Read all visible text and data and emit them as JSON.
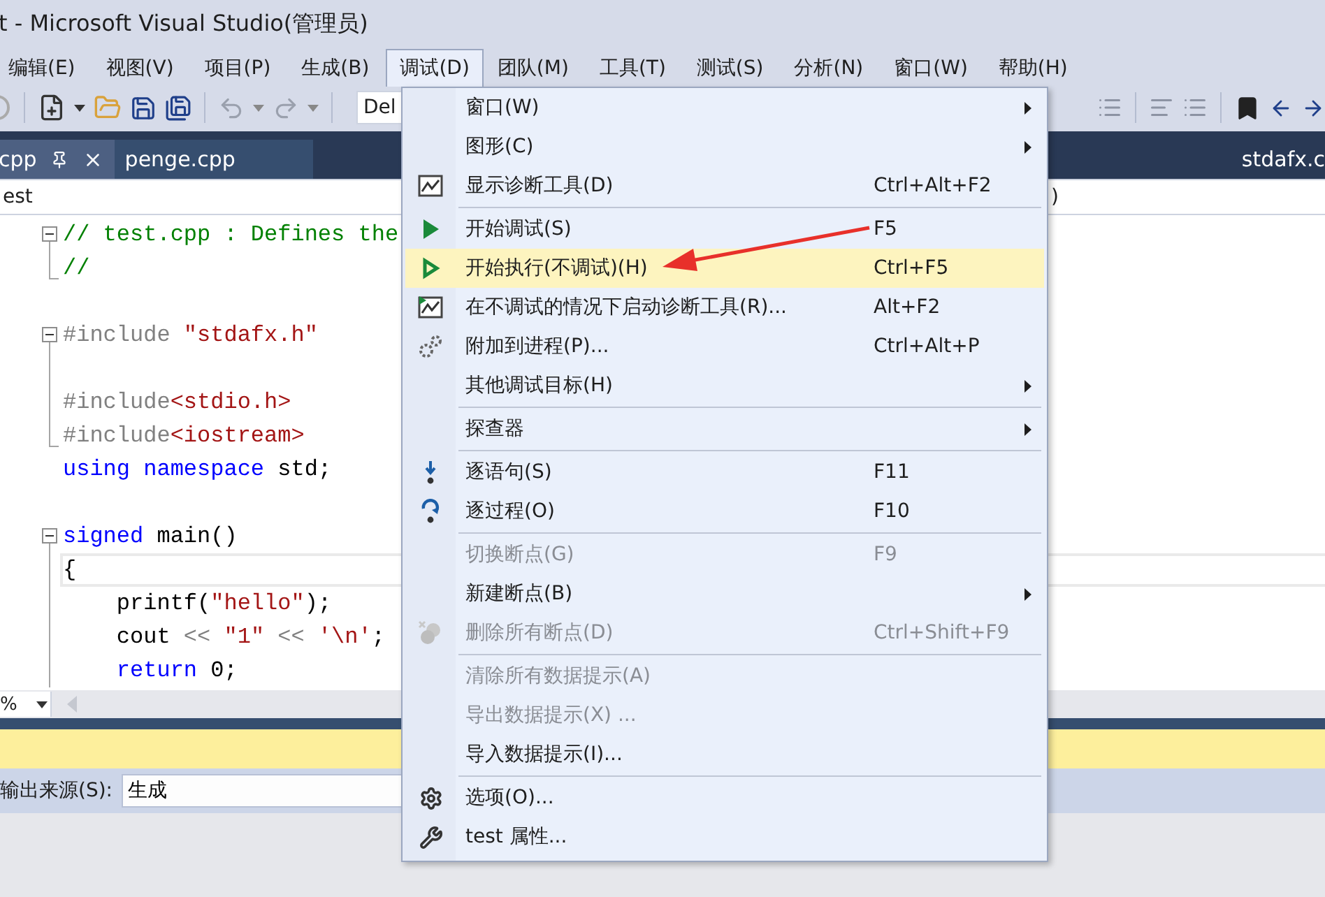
{
  "window": {
    "title": "t - Microsoft Visual Studio(管理员)"
  },
  "menubar": [
    {
      "label": "编辑(E)",
      "selected": false
    },
    {
      "label": "视图(V)",
      "selected": false
    },
    {
      "label": "项目(P)",
      "selected": false
    },
    {
      "label": "生成(B)",
      "selected": false
    },
    {
      "label": "调试(D)",
      "selected": true
    },
    {
      "label": "团队(M)",
      "selected": false
    },
    {
      "label": "工具(T)",
      "selected": false
    },
    {
      "label": "测试(S)",
      "selected": false
    },
    {
      "label": "分析(N)",
      "selected": false
    },
    {
      "label": "窗口(W)",
      "selected": false
    },
    {
      "label": "帮助(H)",
      "selected": false
    }
  ],
  "toolbar": {
    "configuration": "Del"
  },
  "tabs": [
    {
      "label": "cpp",
      "selected": true
    },
    {
      "label": "penge.cpp",
      "selected": false
    }
  ],
  "overflow_tab": {
    "label": "stdafx.c"
  },
  "nav_bar": {
    "project": "est",
    "scope": ")"
  },
  "editor": {
    "lines": [
      {
        "collapsible": true,
        "region_end": false,
        "current": false,
        "tokens": [
          {
            "kind": "comment",
            "text": "// test.cpp : Defines the"
          }
        ]
      },
      {
        "collapsible": false,
        "region_end": true,
        "current": false,
        "tokens": [
          {
            "kind": "comment",
            "text": "//"
          }
        ]
      },
      {
        "collapsible": false,
        "region_end": false,
        "current": false
      },
      {
        "collapsible": true,
        "region_end": false,
        "current": false,
        "tokens": [
          {
            "kind": "preproc",
            "text": "#include "
          },
          {
            "kind": "string",
            "text": "\"stdafx.h\""
          }
        ]
      },
      {
        "collapsible": false,
        "region_end": false,
        "current": false
      },
      {
        "collapsible": false,
        "region_end": false,
        "current": false,
        "tokens": [
          {
            "kind": "preproc",
            "text": "#include"
          },
          {
            "kind": "string",
            "text": "<stdio.h>"
          }
        ]
      },
      {
        "collapsible": false,
        "region_end": true,
        "current": false,
        "tokens": [
          {
            "kind": "preproc",
            "text": "#include"
          },
          {
            "kind": "string",
            "text": "<iostream>"
          }
        ]
      },
      {
        "collapsible": false,
        "region_end": false,
        "current": false,
        "tokens": [
          {
            "kind": "keyword",
            "text": "using "
          },
          {
            "kind": "keyword",
            "text": "namespace"
          },
          {
            "kind": "plain",
            "text": " std;"
          }
        ]
      },
      {
        "collapsible": false,
        "region_end": false,
        "current": false
      },
      {
        "collapsible": true,
        "region_end": false,
        "current": false,
        "tokens": [
          {
            "kind": "keyword",
            "text": "signed"
          },
          {
            "kind": "plain",
            "text": " main()"
          }
        ]
      },
      {
        "collapsible": false,
        "region_end": false,
        "current": true,
        "tokens": [
          {
            "kind": "plain",
            "text": "{"
          }
        ]
      },
      {
        "collapsible": false,
        "region_end": false,
        "current": false,
        "tokens": [
          {
            "kind": "plain",
            "text": "    printf("
          },
          {
            "kind": "string",
            "text": "\"hello\""
          },
          {
            "kind": "plain",
            "text": ");"
          }
        ]
      },
      {
        "collapsible": false,
        "region_end": false,
        "current": false,
        "tokens": [
          {
            "kind": "plain",
            "text": "    cout "
          },
          {
            "kind": "operator",
            "text": "<< "
          },
          {
            "kind": "string",
            "text": "\"1\" "
          },
          {
            "kind": "operator",
            "text": "<< "
          },
          {
            "kind": "string",
            "text": "'\\n'"
          },
          {
            "kind": "plain",
            "text": ";"
          }
        ]
      },
      {
        "collapsible": false,
        "region_end": false,
        "current": false,
        "tokens": [
          {
            "kind": "keyword",
            "text": "    return"
          },
          {
            "kind": "plain",
            "text": " 0;"
          }
        ]
      }
    ]
  },
  "zoom": "%",
  "output": {
    "source_label": "输出来源(S):",
    "source": "生成"
  },
  "debug_menu": {
    "groups": [
      [
        {
          "label": "窗口(W)",
          "submenu": true,
          "disabled": false,
          "selected": false
        },
        {
          "label": "图形(C)",
          "submenu": true,
          "disabled": false,
          "selected": false
        },
        {
          "label": "显示诊断工具(D)",
          "shortcut": "Ctrl+Alt+F2",
          "submenu": false,
          "disabled": false,
          "selected": false
        }
      ],
      [
        {
          "label": "开始调试(S)",
          "shortcut": "F5",
          "submenu": false,
          "disabled": false,
          "selected": false
        },
        {
          "label": "开始执行(不调试)(H)",
          "shortcut": "Ctrl+F5",
          "submenu": false,
          "disabled": false,
          "selected": true
        },
        {
          "label": "在不调试的情况下启动诊断工具(R)...",
          "shortcut": "Alt+F2",
          "submenu": false,
          "disabled": false,
          "selected": false
        },
        {
          "label": "附加到进程(P)...",
          "shortcut": "Ctrl+Alt+P",
          "submenu": false,
          "disabled": false,
          "selected": false
        },
        {
          "label": "其他调试目标(H)",
          "submenu": true,
          "disabled": false,
          "selected": false
        }
      ],
      [
        {
          "label": "探查器",
          "submenu": true,
          "disabled": false,
          "selected": false
        }
      ],
      [
        {
          "label": "逐语句(S)",
          "shortcut": "F11",
          "submenu": false,
          "disabled": false,
          "selected": false
        },
        {
          "label": "逐过程(O)",
          "shortcut": "F10",
          "submenu": false,
          "disabled": false,
          "selected": false
        }
      ],
      [
        {
          "label": "切换断点(G)",
          "shortcut": "F9",
          "submenu": false,
          "disabled": true,
          "selected": false
        },
        {
          "label": "新建断点(B)",
          "submenu": true,
          "disabled": false,
          "selected": false
        },
        {
          "label": "删除所有断点(D)",
          "shortcut": "Ctrl+Shift+F9",
          "submenu": false,
          "disabled": true,
          "selected": false
        }
      ],
      [
        {
          "label": "清除所有数据提示(A)",
          "submenu": false,
          "disabled": true,
          "selected": false
        },
        {
          "label": "导出数据提示(X) ...",
          "submenu": false,
          "disabled": true,
          "selected": false
        },
        {
          "label": "导入数据提示(I)...",
          "submenu": false,
          "disabled": false,
          "selected": false
        }
      ],
      [
        {
          "label": "选项(O)...",
          "submenu": false,
          "disabled": false,
          "selected": false
        },
        {
          "label": "test 属性...",
          "submenu": false,
          "disabled": false,
          "selected": false
        }
      ]
    ]
  }
}
